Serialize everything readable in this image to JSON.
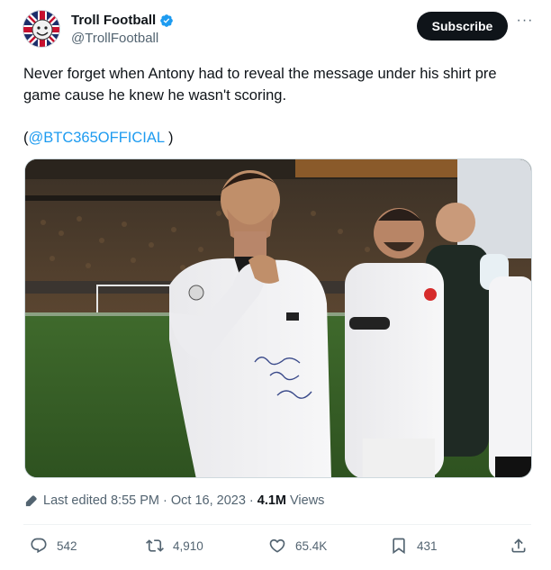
{
  "author": {
    "display_name": "Troll Football",
    "handle": "@TrollFootball",
    "verified_icon": "verified-badge-icon"
  },
  "header": {
    "subscribe_label": "Subscribe",
    "more_label": "···"
  },
  "tweet": {
    "text": "Never forget when Antony had to reveal the message under his shirt pre game cause he knew he wasn't scoring.",
    "mention_open": "(",
    "mention": "@BTC365OFFICIAL",
    "mention_close": " )"
  },
  "meta": {
    "edited_label": "Last edited 8:55 PM · Oct 16, 2023 ·",
    "views_count": "4.1M",
    "views_label": "Views"
  },
  "actions": {
    "replies": "542",
    "reposts": "4,910",
    "likes": "65.4K",
    "bookmarks": "431"
  },
  "colors": {
    "accent": "#1d9bf0",
    "text": "#0f1419",
    "muted": "#536471",
    "button_bg": "#0f1419"
  }
}
